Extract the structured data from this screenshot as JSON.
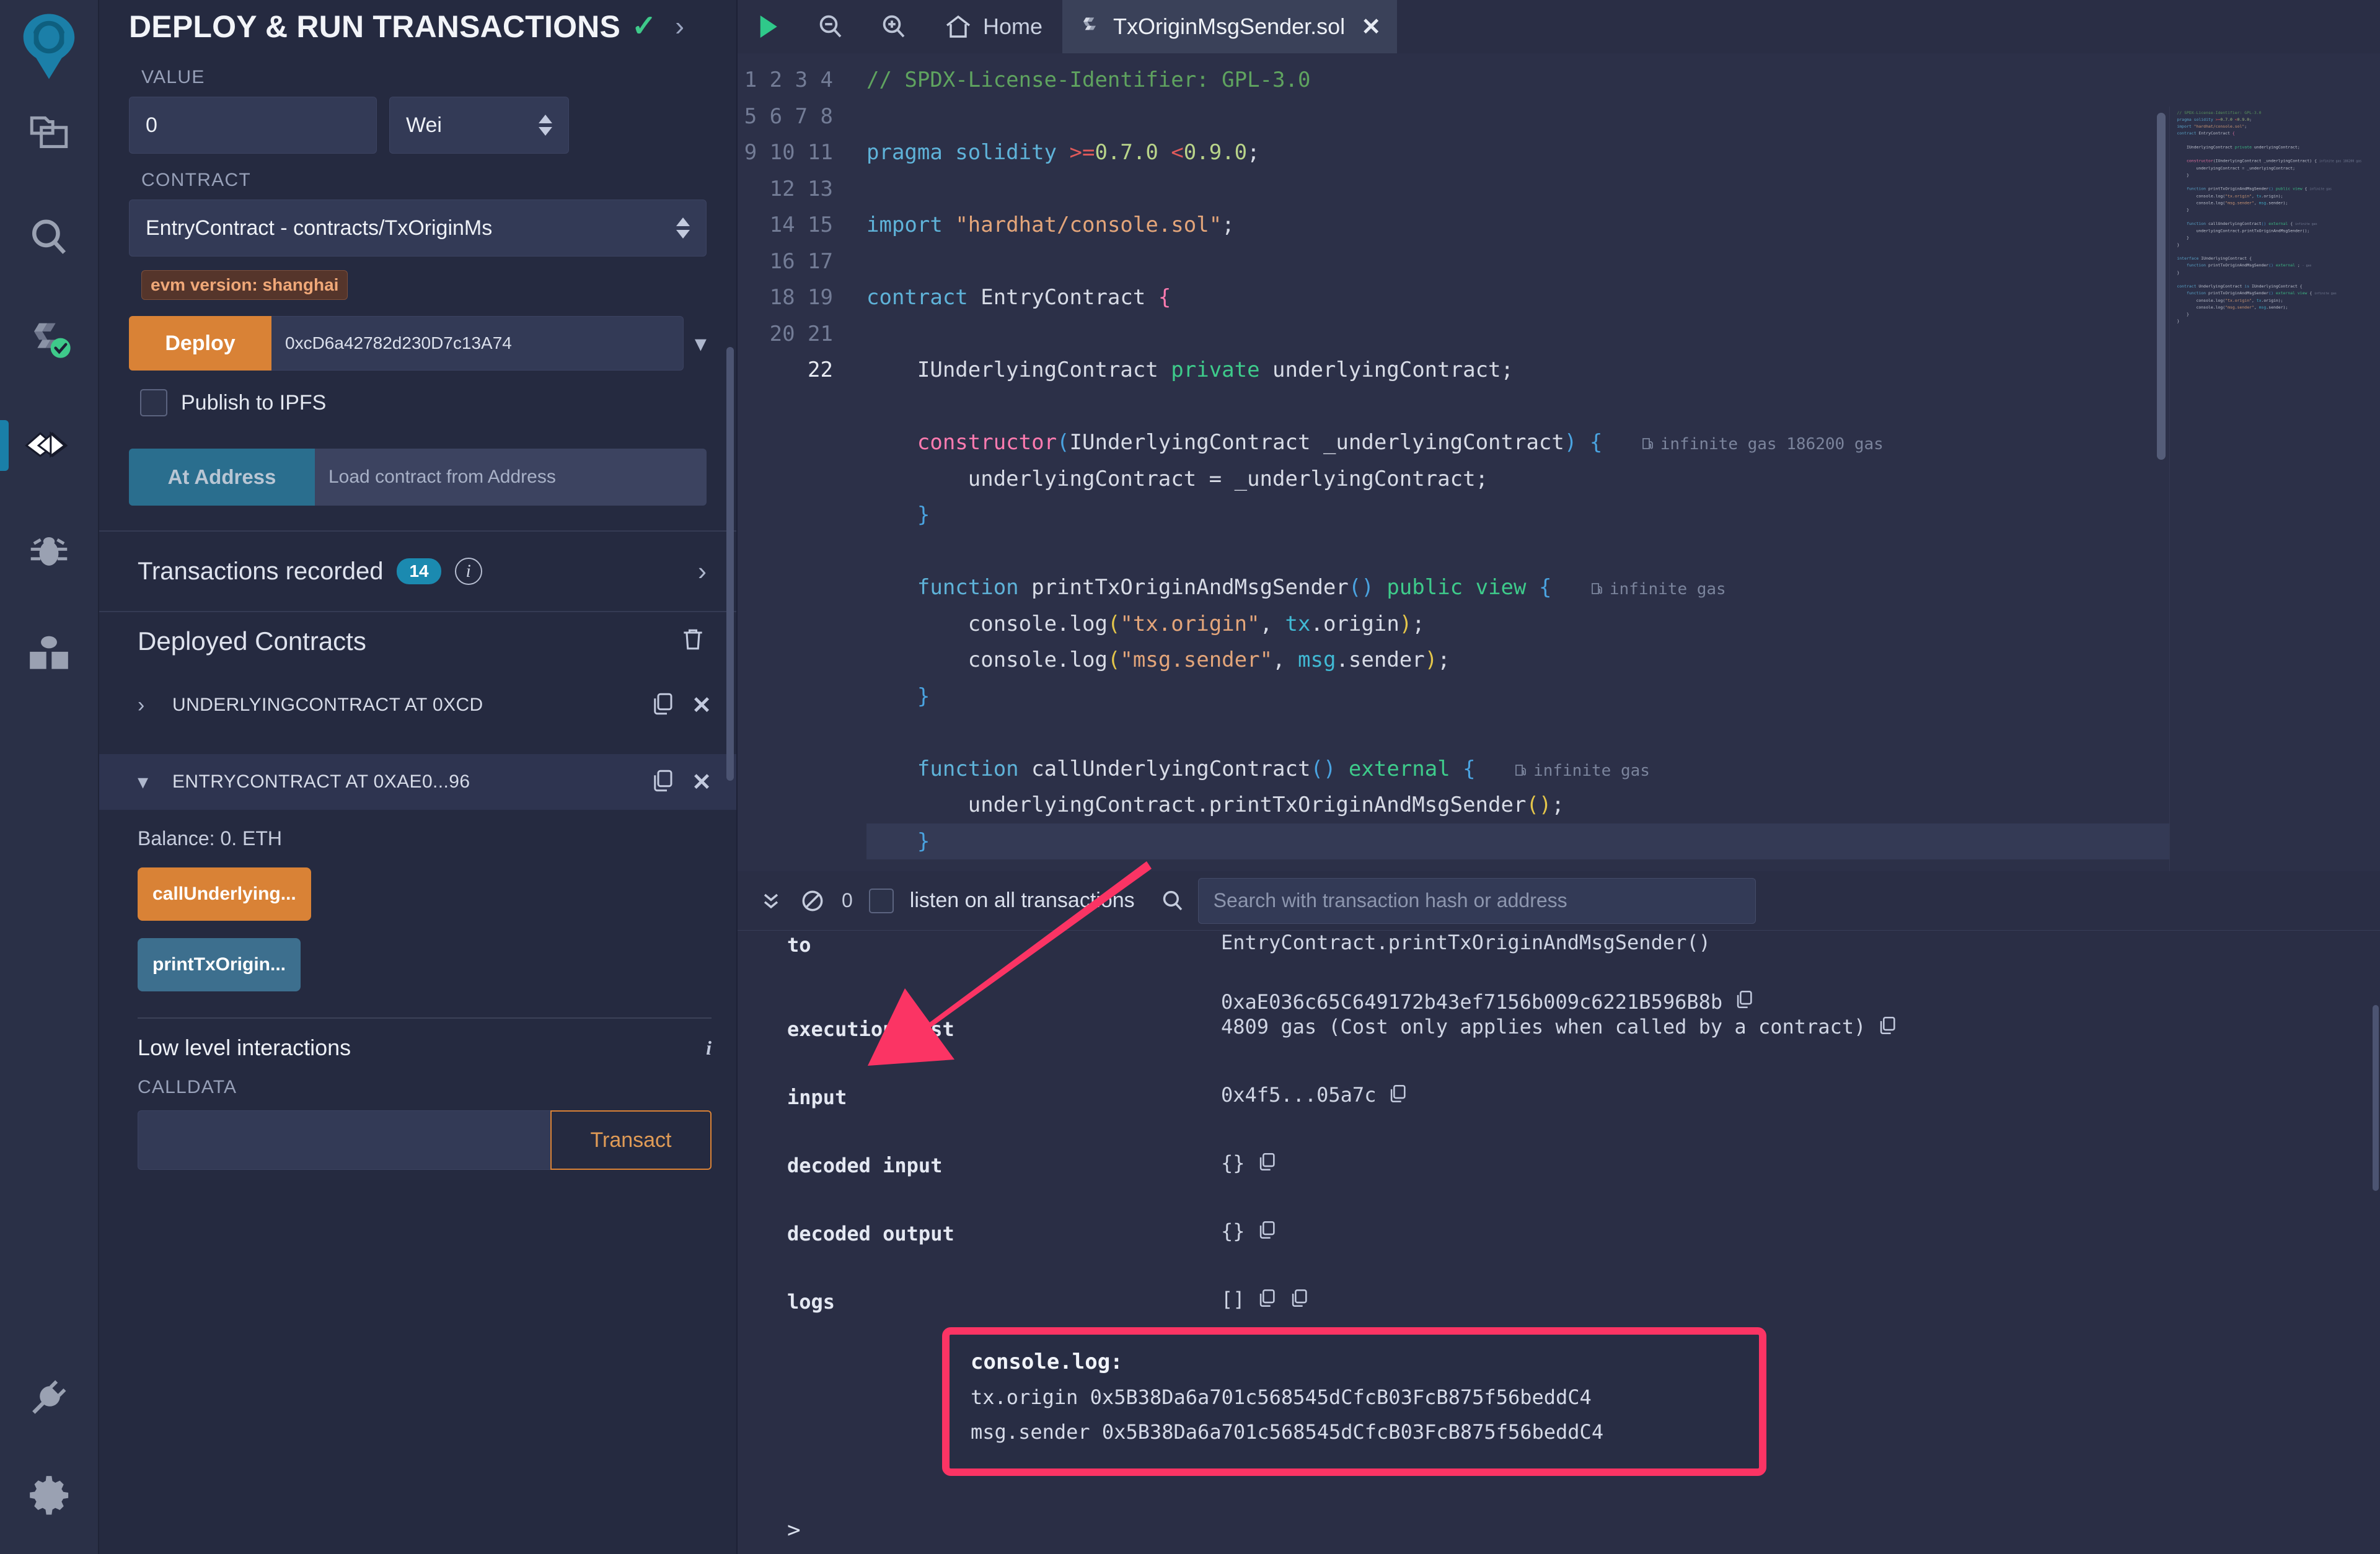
{
  "rail": {
    "logo": "remix-logo",
    "items": [
      {
        "name": "file-explorer-icon",
        "label": "File explorer"
      },
      {
        "name": "search-icon",
        "label": "Search in files"
      },
      {
        "name": "solidity-compiler-icon",
        "label": "Solidity compiler"
      },
      {
        "name": "deploy-run-icon",
        "label": "Deploy & run transactions",
        "active": true
      },
      {
        "name": "debugger-icon",
        "label": "Debugger"
      },
      {
        "name": "learneth-icon",
        "label": "LearnEth"
      }
    ],
    "bottom": [
      {
        "name": "plugin-manager-icon",
        "label": "Plugin manager"
      },
      {
        "name": "settings-gear-icon",
        "label": "Settings"
      }
    ]
  },
  "panel": {
    "title": "DEPLOY & RUN TRANSACTIONS",
    "value_label": "VALUE",
    "value_amount": "0",
    "value_unit": "Wei",
    "contract_label": "CONTRACT",
    "contract_selected": "EntryContract - contracts/TxOriginMs",
    "evm_badge": "evm version: shanghai",
    "deploy_button": "Deploy",
    "deploy_address": "0xcD6a42782d230D7c13A74",
    "publish_ipfs_label": "Publish to IPFS",
    "at_address_button": "At Address",
    "at_address_placeholder": "Load contract from Address",
    "transactions_recorded_label": "Transactions recorded",
    "transactions_recorded_count": "14",
    "deployed_contracts_title": "Deployed Contracts",
    "contracts": [
      {
        "name": "UNDERLYINGCONTRACT AT 0XCD",
        "expanded": false
      },
      {
        "name": "ENTRYCONTRACT AT 0XAE0...96",
        "expanded": true
      }
    ],
    "balance": "Balance: 0. ETH",
    "fn_buttons": [
      {
        "label": "callUnderlying...",
        "color": "orange"
      },
      {
        "label": "printTxOrigin...",
        "color": "blue"
      }
    ],
    "low_level_title": "Low level interactions",
    "calldata_label": "CALLDATA",
    "calldata_value": "",
    "transact_button": "Transact"
  },
  "editor": {
    "home_tab": "Home",
    "file_tab": "TxOriginMsgSender.sol",
    "line_numbers": [
      "1",
      "2",
      "3",
      "4",
      "5",
      "6",
      "7",
      "8",
      "9",
      "10",
      "11",
      "12",
      "13",
      "14",
      "15",
      "16",
      "17",
      "18",
      "19",
      "20",
      "21",
      "22"
    ],
    "gas_annotations": [
      {
        "line": 11,
        "text": "infinite gas 186200 gas"
      },
      {
        "line": 15,
        "text": "infinite gas"
      },
      {
        "line": 20,
        "text": "infinite gas"
      }
    ],
    "source_lines": [
      "// SPDX-License-Identifier: GPL-3.0",
      "",
      "pragma solidity >=0.7.0 <0.9.0;",
      "",
      "import \"hardhat/console.sol\";",
      "",
      "contract EntryContract {",
      "",
      "    IUnderlyingContract private underlyingContract;",
      "",
      "    constructor(IUnderlyingContract _underlyingContract) {",
      "        underlyingContract = _underlyingContract;",
      "    }",
      "",
      "    function printTxOriginAndMsgSender() public view {",
      "        console.log(\"tx.origin\", tx.origin);",
      "        console.log(\"msg.sender\", msg.sender);",
      "    }",
      "",
      "    function callUnderlyingContract() external {",
      "        underlyingContract.printTxOriginAndMsgSender();",
      "    }"
    ]
  },
  "terminal": {
    "listen_label": "listen on all transactions",
    "pending_count": "0",
    "search_placeholder": "Search with transaction hash or address",
    "rows": [
      {
        "key": "to",
        "value": "EntryContract.printTxOriginAndMsgSender()",
        "value2": "0xaE036c65C649172b43ef7156b009c6221B596B8b",
        "copy": true
      },
      {
        "key": "execution cost",
        "value": "4809 gas (Cost only applies when called by a contract)",
        "copy": true
      },
      {
        "key": "input",
        "value": "0x4f5...05a7c",
        "copy": true
      },
      {
        "key": "decoded input",
        "value": "{}",
        "copy": true
      },
      {
        "key": "decoded output",
        "value": "{}",
        "copy": true
      },
      {
        "key": "logs",
        "value": "[]",
        "copy": true,
        "copy2": true
      }
    ],
    "console": {
      "title": "console.log:",
      "line1": "tx.origin 0x5B38Da6a701c568545dCfcB03FcB875f56beddC4",
      "line2": "msg.sender 0x5B38Da6a701c568545dCfcB03FcB875f56beddC4"
    },
    "prompt": ">"
  },
  "colors": {
    "accent_orange": "#d98236",
    "accent_blue": "#1b8ab0",
    "highlight_pink": "#fb3464",
    "success_green": "#3ec98a"
  }
}
